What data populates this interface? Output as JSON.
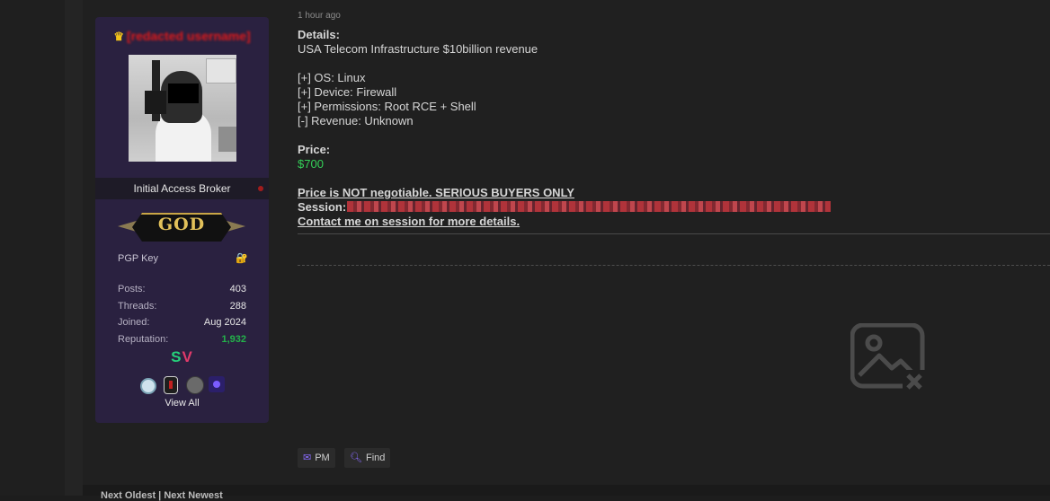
{
  "post": {
    "timestamp": "1 hour ago",
    "details_heading": "Details:",
    "details_title": "USA Telecom Infrastructure $10billion revenue",
    "specs": [
      "[+] OS: Linux",
      "[+] Device: Firewall",
      "[+] Permissions: Root RCE + Shell",
      "[-] Revenue: Unknown"
    ],
    "price_label": "Price:",
    "price_value": "$700",
    "notice": "Price is NOT negotiable. SERIOUS BUYERS ONLY",
    "session_label": "Session:",
    "contact": "Contact me on session for more details.",
    "price_color": "#34d058"
  },
  "user": {
    "username": "[redacted username]",
    "rank_title": "Initial Access Broker",
    "group_badge": "GOD",
    "pgp_label": "PGP Key",
    "stats": [
      {
        "label": "Posts:",
        "value": "403"
      },
      {
        "label": "Threads:",
        "value": "288"
      },
      {
        "label": "Joined:",
        "value": "Aug 2024"
      },
      {
        "label": "Reputation:",
        "value": "1,932"
      }
    ],
    "sv_s": "S",
    "sv_v": "V",
    "view_all": "View All",
    "card_color": "#2a2140",
    "username_color": "#e01a1a"
  },
  "actions": {
    "pm_label": "PM",
    "find_label": "Find"
  },
  "footer": {
    "partial_text": "Next Oldest | Next Newest"
  },
  "icons": {
    "crown": "crown-icon",
    "lock": "lock-icon",
    "broken_image": "broken-image-icon",
    "mail": "mail-icon",
    "search": "search-icon"
  }
}
